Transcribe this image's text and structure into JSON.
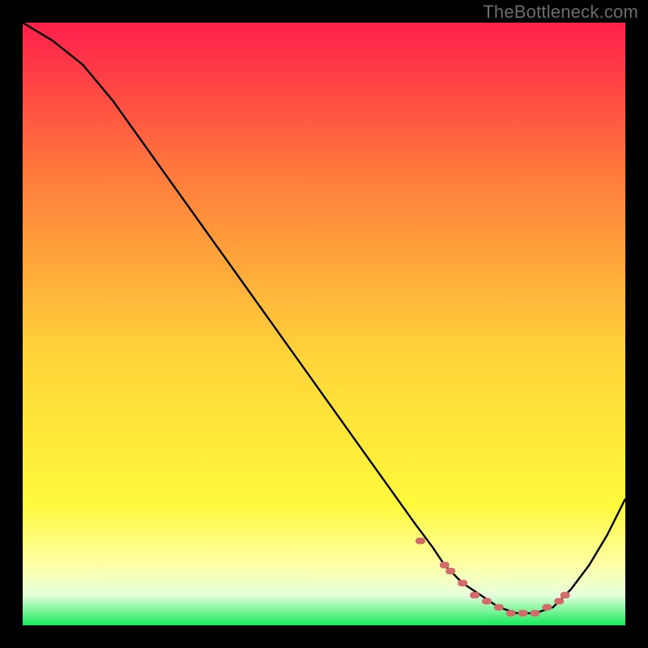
{
  "watermark": "TheBottleneck.com",
  "colors": {
    "gradient_top": "#ff1f4b",
    "gradient_mid1": "#ff7a3c",
    "gradient_mid2": "#ffd43a",
    "gradient_mid3": "#fff93b",
    "gradient_mid4": "#fdffa5",
    "gradient_mid5": "#e6ffdc",
    "gradient_bottom": "#15ea5a",
    "curve": "#000000",
    "markers": "#d46a6a"
  },
  "chart_data": {
    "type": "line",
    "title": "",
    "xlabel": "",
    "ylabel": "",
    "xlim": [
      0,
      100
    ],
    "ylim": [
      0,
      100
    ],
    "grid": false,
    "series": [
      {
        "name": "bottleneck-curve",
        "x": [
          0,
          5,
          10,
          15,
          20,
          25,
          30,
          35,
          40,
          45,
          50,
          55,
          60,
          65,
          68,
          70,
          73,
          76,
          79,
          82,
          85,
          88,
          91,
          94,
          97,
          100
        ],
        "y": [
          100,
          97,
          93,
          87,
          80,
          73,
          66,
          59,
          52,
          45,
          38,
          31,
          24,
          17,
          13,
          10,
          7,
          5,
          3,
          2,
          2,
          3,
          6,
          10,
          15,
          21
        ]
      }
    ],
    "markers": {
      "name": "highlight-dots",
      "x": [
        66,
        70,
        71,
        73,
        75,
        77,
        79,
        81,
        83,
        85,
        87,
        89,
        90
      ],
      "y": [
        14,
        10,
        9,
        7,
        5,
        4,
        3,
        2,
        2,
        2,
        3,
        4,
        5
      ]
    }
  }
}
